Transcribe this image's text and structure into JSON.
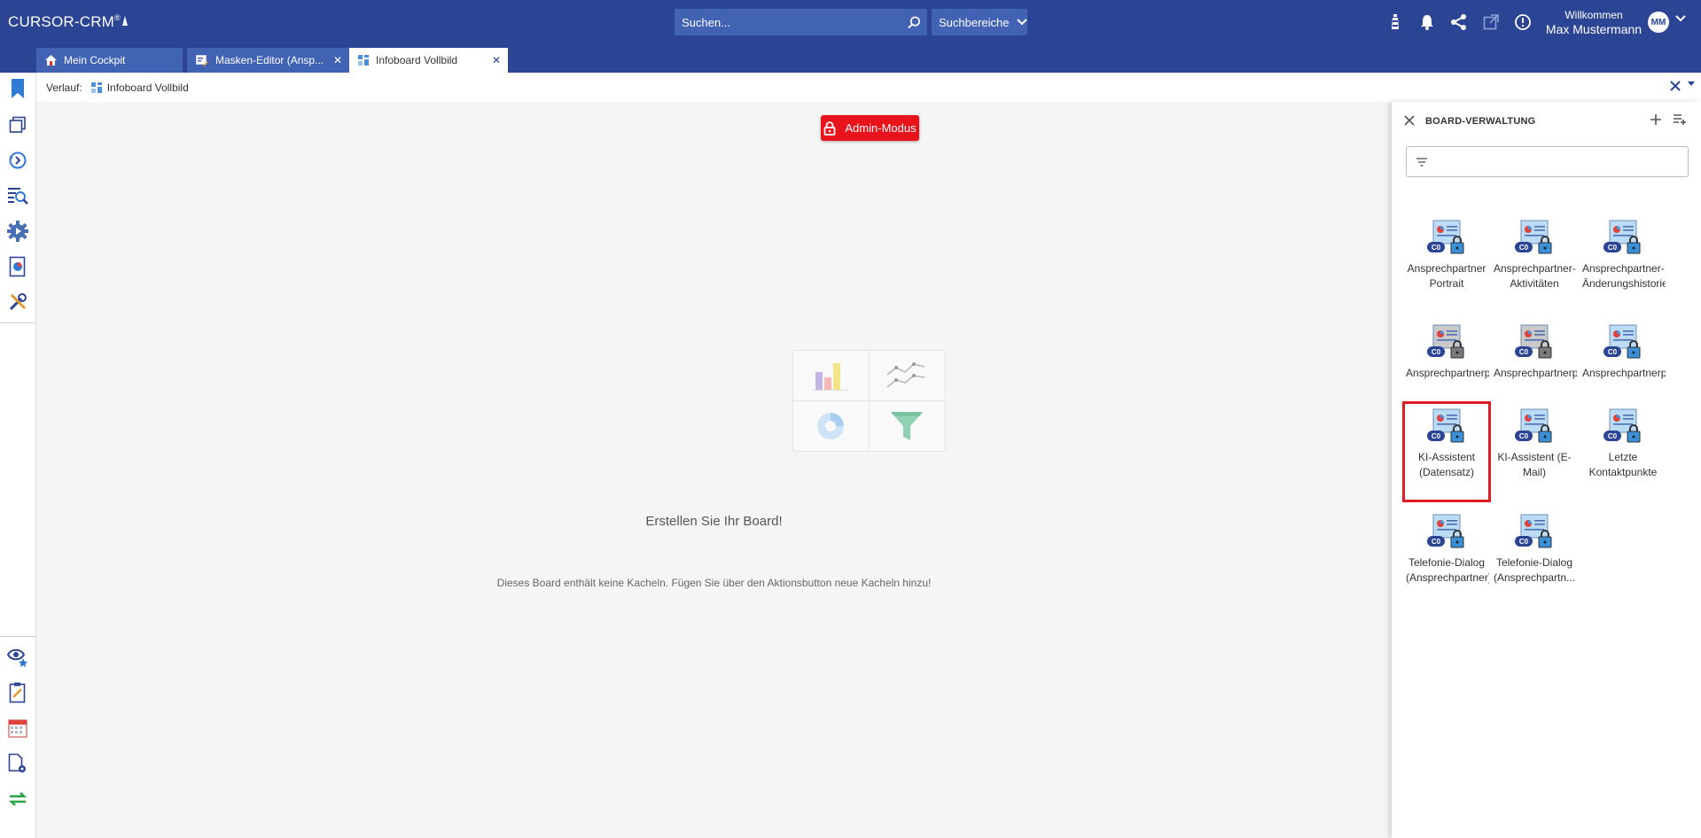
{
  "header": {
    "logo": "CURSOR-CRM",
    "search_placeholder": "Suchen...",
    "scope_label": "Suchbereiche",
    "welcome": "Willkommen",
    "user_name": "Max Mustermann",
    "avatar_initials": "MM"
  },
  "tabs": [
    {
      "label": "Mein Cockpit"
    },
    {
      "label": "Masken-Editor (Ansp..."
    },
    {
      "label": "Infoboard Vollbild"
    }
  ],
  "breadcrumb": {
    "prefix": "Verlauf:",
    "item": "Infoboard Vollbild"
  },
  "main": {
    "admin_label": "Admin-Modus",
    "empty_title": "Erstellen Sie Ihr Board!",
    "empty_text": "Dieses Board enthält keine Kacheln. Fügen Sie über den Aktionsbutton neue Kacheln hinzu!"
  },
  "panel": {
    "title": "BOARD-VERWALTUNG",
    "filter_value": "",
    "tiles": [
      {
        "line1": "Ansprechpartner",
        "line2": "Portrait",
        "variant": "blue"
      },
      {
        "line1": "Ansprechpartner-",
        "line2": "Aktivitäten",
        "variant": "blue"
      },
      {
        "line1": "Ansprechpartner-",
        "line2": "Änderungshistorie",
        "variant": "blue"
      },
      {
        "line1": "Ansprechpartnerp",
        "line2": "",
        "variant": "gray"
      },
      {
        "line1": "Ansprechpartnerp",
        "line2": "",
        "variant": "gray"
      },
      {
        "line1": "Ansprechpartnerp",
        "line2": "",
        "variant": "blue"
      },
      {
        "line1": "KI-Assistent",
        "line2": "(Datensatz)",
        "variant": "blue"
      },
      {
        "line1": "KI-Assistent (E-",
        "line2": "Mail)",
        "variant": "blue"
      },
      {
        "line1": "Letzte",
        "line2": "Kontaktpunkte",
        "variant": "blue"
      },
      {
        "line1": "Telefonie-Dialog",
        "line2": "(Ansprechpartner)",
        "variant": "blue"
      },
      {
        "line1": "Telefonie-Dialog",
        "line2": "(Ansprechpartn...",
        "variant": "blue"
      }
    ],
    "tile_badge": "C0",
    "selected_tile": "KI-Assistent (Datensatz)"
  },
  "colors": {
    "brand": "#2b4494",
    "tab_inactive": "#4262b4",
    "admin": "#e8131b",
    "selection": "#e01b24"
  },
  "icons": {
    "sidebar_top": [
      "bookmark-icon",
      "windows-icon",
      "history-icon",
      "search-list-icon",
      "gear-play-icon",
      "report-icon",
      "tools-icon"
    ],
    "sidebar_bottom": [
      "watch-star-icon",
      "notes-icon",
      "calendar-icon",
      "document-settings-icon",
      "sync-icon"
    ]
  }
}
